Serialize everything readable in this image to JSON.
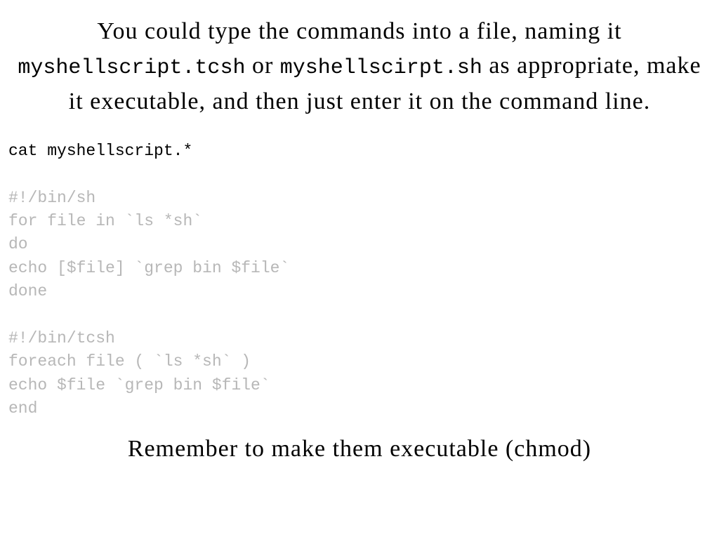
{
  "intro": {
    "part1": "You could type the commands into a file, naming it ",
    "file1": "myshellscript.tcsh",
    "part2": " or ",
    "file2": "myshellscirpt.sh",
    "part3": " as appropriate, make it executable, and then just enter it on the command line."
  },
  "code": {
    "cmd": "cat myshellscript.*",
    "block1": "#!/bin/sh\nfor file in `ls *sh`\ndo\necho [$file] `grep bin $file`\ndone",
    "block2": "#!/bin/tcsh\nforeach file ( `ls *sh` )\necho $file `grep bin $file`\nend"
  },
  "footer": "Remember to make them executable (chmod)"
}
